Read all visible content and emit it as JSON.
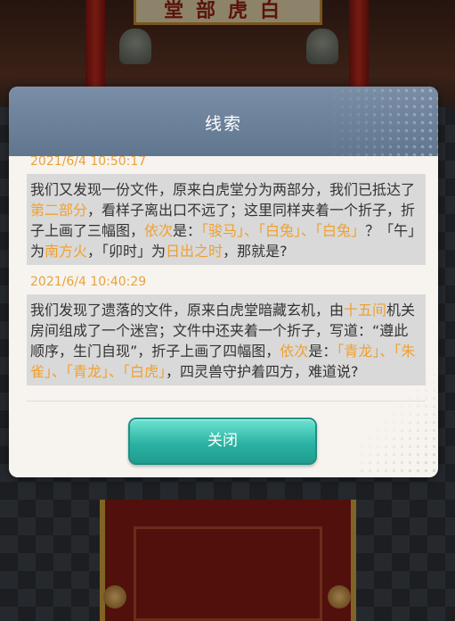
{
  "scene": {
    "sign_text": "堂部虎白"
  },
  "dialog": {
    "title": "线索",
    "close_label": "关闭",
    "entries": [
      {
        "timestamp": "2021/6/4 10:50:17",
        "segments": [
          {
            "text": "我们又发现一份文件，原来白虎堂分为两部分，我们已抵达了",
            "highlight": false
          },
          {
            "text": "第二部分",
            "highlight": true
          },
          {
            "text": "，看样子离出口不远了；这里同样夹着一个折子，折子上画了三幅图，",
            "highlight": false
          },
          {
            "text": "依次",
            "highlight": true
          },
          {
            "text": "是：",
            "highlight": false
          },
          {
            "text": "「骏马」、「白兔」、「白兔」",
            "highlight": true
          },
          {
            "text": "？「午」为",
            "highlight": false
          },
          {
            "text": "南方火",
            "highlight": true
          },
          {
            "text": "，「卯时」为",
            "highlight": false
          },
          {
            "text": "日出之时",
            "highlight": true
          },
          {
            "text": "，那就是?",
            "highlight": false
          }
        ]
      },
      {
        "timestamp": "2021/6/4 10:40:29",
        "segments": [
          {
            "text": "我们发现了遗落的文件，原来白虎堂暗藏玄机，由",
            "highlight": false
          },
          {
            "text": "十五间",
            "highlight": true
          },
          {
            "text": "机关房间组成了一个迷宫；文件中还夹着一个折子，写道：“遵此顺序，生门自现”，折子上画了四幅图，",
            "highlight": false
          },
          {
            "text": "依次",
            "highlight": true
          },
          {
            "text": "是：",
            "highlight": false
          },
          {
            "text": "「青龙」、「朱雀」、「青龙」、「白虎」",
            "highlight": true
          },
          {
            "text": "，四灵兽守护着四方，难道说?",
            "highlight": false
          }
        ]
      }
    ]
  },
  "colors": {
    "highlight": "#f0a030",
    "timestamp": "#e8a33a",
    "header": "#6b809a",
    "button": "#2bb3a3"
  }
}
